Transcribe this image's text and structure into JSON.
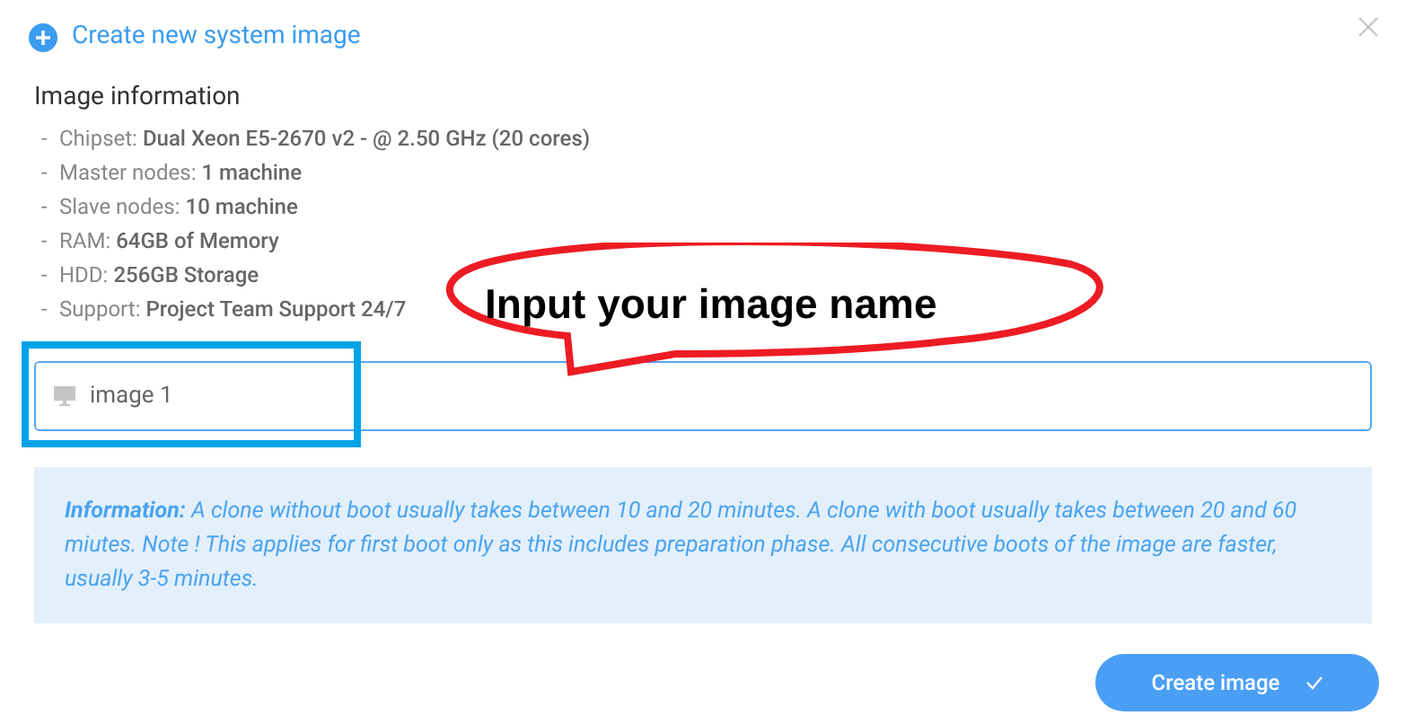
{
  "dialog": {
    "title": "Create new system image"
  },
  "image_information": {
    "heading": "Image information",
    "items": [
      {
        "bullet": "-",
        "text": "Chipset: **Dual Xeon E5-2670 v2 - @ 2.50 GHz (20 cores)**"
      },
      {
        "bullet": "-",
        "text": "Master nodes: **1 machine**"
      },
      {
        "bullet": "-",
        "text": "Slave nodes: **10 machine**"
      },
      {
        "bullet": "-",
        "text": "RAM: **64GB of Memory**"
      },
      {
        "bullet": "-",
        "text": "HDD: **256GB Storage**"
      },
      {
        "bullet": "-",
        "text": "Support: **Project Team Support 24/7**"
      }
    ]
  },
  "name_field": {
    "value": "image 1"
  },
  "info_note": {
    "text": "**Information:** A clone without boot usually takes between 10 and 20 minutes. A clone with boot usually takes between 20 and 60 miutes. Note ! This applies for first boot only as this includes preparation phase. All consecutive boots of the image are faster, usually 3-5 minutes."
  },
  "buttons": [
    {
      "label": "Create image"
    }
  ],
  "annotation": {
    "callout": "Input your image name"
  }
}
